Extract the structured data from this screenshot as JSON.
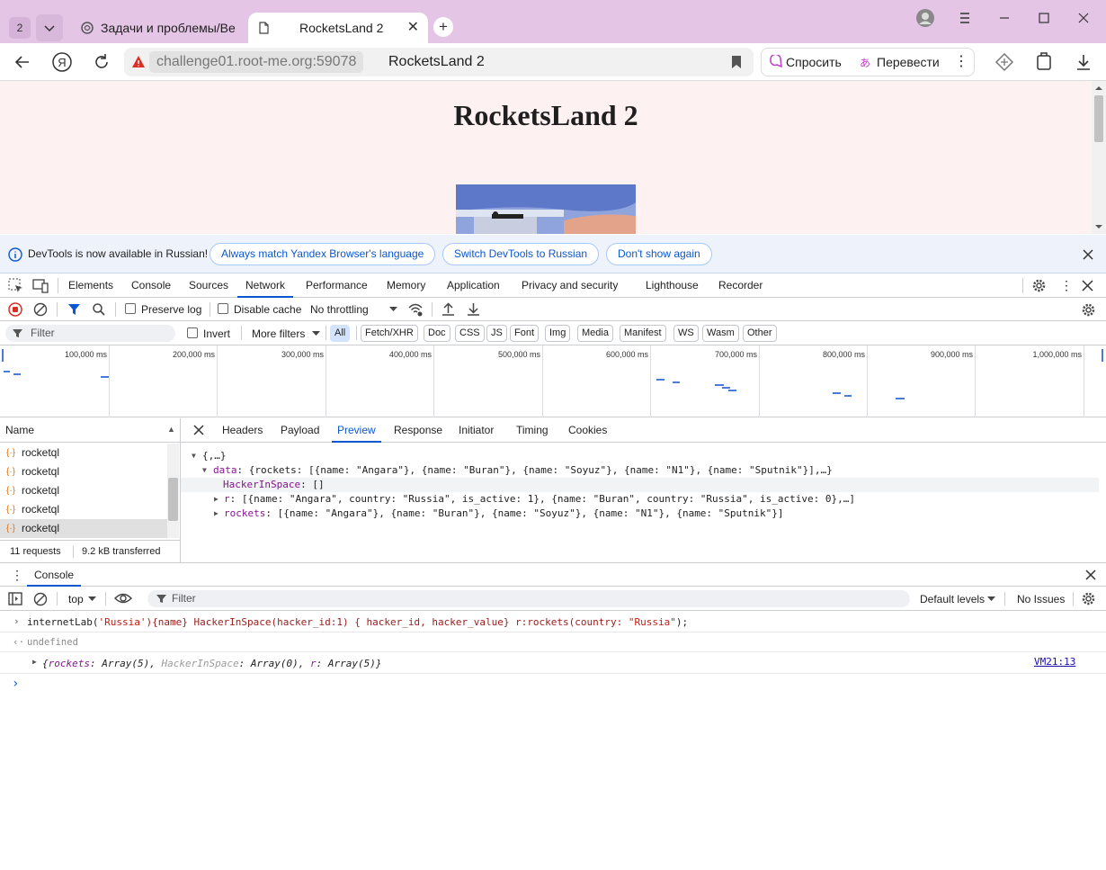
{
  "browser": {
    "tab_count": "2",
    "tabs": [
      {
        "title": "Задачи и проблемы/Веб"
      },
      {
        "title": "RocketsLand 2"
      }
    ],
    "host": "challenge01.root-me.org:59078",
    "page_title": "RocketsLand 2",
    "ask_label": "Спросить",
    "translate_label": "Перевести"
  },
  "page": {
    "heading": "RocketsLand 2"
  },
  "infobar": {
    "message": "DevTools is now available in Russian!",
    "btn_match": "Always match Yandex Browser's language",
    "btn_switch": "Switch DevTools to Russian",
    "btn_dismiss": "Don't show again"
  },
  "devtools": {
    "tabs": [
      "Elements",
      "Console",
      "Sources",
      "Network",
      "Performance",
      "Memory",
      "Application",
      "Privacy and security",
      "Lighthouse",
      "Recorder"
    ],
    "network": {
      "preserve_log": "Preserve log",
      "disable_cache": "Disable cache",
      "throttling": "No throttling",
      "filter_placeholder": "Filter",
      "invert": "Invert",
      "more_filters": "More filters",
      "types": [
        "All",
        "Fetch/XHR",
        "Doc",
        "CSS",
        "JS",
        "Font",
        "Img",
        "Media",
        "Manifest",
        "WS",
        "Wasm",
        "Other"
      ],
      "ticks": [
        "100,000 ms",
        "200,000 ms",
        "300,000 ms",
        "400,000 ms",
        "500,000 ms",
        "600,000 ms",
        "700,000 ms",
        "800,000 ms",
        "900,000 ms",
        "1,000,000 ms"
      ],
      "name_header": "Name",
      "requests": [
        "rocketql",
        "rocketql",
        "rocketql",
        "rocketql",
        "rocketql"
      ],
      "footer_requests": "11 requests",
      "footer_transferred": "9.2 kB transferred",
      "detail_tabs": [
        "Headers",
        "Payload",
        "Preview",
        "Response",
        "Initiator",
        "Timing",
        "Cookies"
      ],
      "preview": {
        "root": "{,…}",
        "data_key": "data",
        "data_val": "{rockets: [{name: \"Angara\"}, {name: \"Buran\"}, {name: \"Soyuz\"}, {name: \"N1\"}, {name: \"Sputnik\"}],…}",
        "hacker_key": "HackerInSpace",
        "hacker_val": "[]",
        "r_key": "r",
        "r_val": "[{name: \"Angara\", country: \"Russia\", is_active: 1}, {name: \"Buran\", country: \"Russia\", is_active: 0},…]",
        "rockets_key": "rockets",
        "rockets_val": "[{name: \"Angara\"}, {name: \"Buran\"}, {name: \"Soyuz\"}, {name: \"N1\"}, {name: \"Sputnik\"}]"
      }
    },
    "console": {
      "drawer_tab": "Console",
      "context": "top",
      "filter_placeholder": "Filter",
      "levels": "Default levels",
      "issues": "No Issues",
      "input_plain": "internetLab(",
      "input_str1": "'Russia'",
      "input_rest": "){name} HackerInSpace(hacker_id:1) { hacker_id, hacker_value} r:rockets(country: ",
      "input_str2": "\"Russia\"",
      "input_end": ");",
      "result_undefined": "undefined",
      "obj_open": "{",
      "obj_k1": "rockets",
      "obj_v1": "Array(5)",
      "obj_k2": "HackerInSpace",
      "obj_v2": "Array(0)",
      "obj_k3": "r",
      "obj_v3": "Array(5)",
      "obj_close": "}",
      "source_link": "VM21:13"
    }
  }
}
